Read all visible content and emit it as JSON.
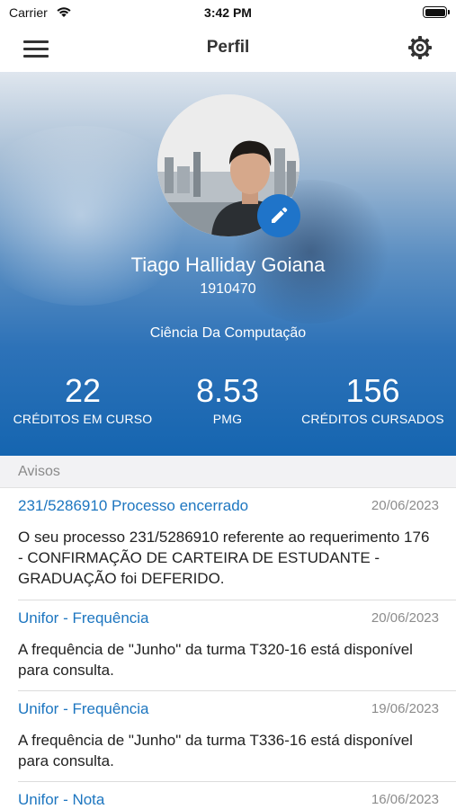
{
  "status_bar": {
    "carrier": "Carrier",
    "time": "3:42 PM"
  },
  "nav": {
    "title": "Perfil"
  },
  "profile": {
    "name": "Tiago Halliday Goiana",
    "id": "1910470",
    "course": "Ciência Da Computação",
    "stats": [
      {
        "value": "22",
        "label": "CRÉDITOS EM CURSO"
      },
      {
        "value": "8.53",
        "label": "PMG"
      },
      {
        "value": "156",
        "label": "CRÉDITOS CURSADOS"
      }
    ]
  },
  "avisos": {
    "header": "Avisos",
    "items": [
      {
        "title": "231/5286910 Processo encerrado",
        "date": "20/06/2023",
        "body": "O seu processo 231/5286910 referente ao requerimento 176 - CONFIRMAÇÃO DE CARTEIRA DE ESTUDANTE - GRADUAÇÃO foi DEFERIDO."
      },
      {
        "title": "Unifor - Frequência",
        "date": "20/06/2023",
        "body": "A frequência de \"Junho\" da turma T320-16 está disponível para consulta."
      },
      {
        "title": "Unifor - Frequência",
        "date": "19/06/2023",
        "body": "A frequência de \"Junho\" da turma T336-16 está disponível para consulta."
      },
      {
        "title": "Unifor - Nota",
        "date": "16/06/2023",
        "body": ""
      }
    ]
  },
  "colors": {
    "accent": "#1d76c0",
    "edit_button": "#1f74c9",
    "header_bottom": "#1565b0"
  },
  "icons": {
    "menu": "hamburger-icon",
    "settings": "gear-icon",
    "edit": "pencil-icon",
    "wifi": "wifi-icon",
    "battery": "battery-icon"
  }
}
